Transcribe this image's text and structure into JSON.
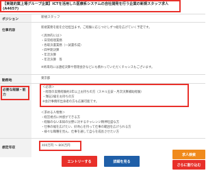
{
  "header": {
    "title_line1": "【東建的業上場グループ企業】ICTを活用した医療系システムの自社開発を行う企業の新規スタッフ求人",
    "title_line2": "(A4657)"
  },
  "position": {
    "label": "ポジション",
    "value": "新規スタッフ"
  },
  "job": {
    "label": "仕事内容",
    "lines": [
      "新規業務を能を企社担当ます。ご経験に応じつけしずつ組を広げていく予定です。",
      "",
      "＜具体的には＞",
      "・日常経理業務",
      "・各取決書業務（一試書作成）",
      "・四半期決算",
      "・年次決算",
      "・年次決算　等",
      "",
      "※将来的には連結決算や管理会計などにも携わっていただくチャンスもございます。"
    ]
  },
  "location": {
    "label": "勤務地",
    "value": "東京都"
  },
  "requirements": {
    "label": "必要な経験・能力",
    "must_lines": [
      "＜必須＞",
      "・経理の実務経験約3年以上お持ちの方（スキル五安・月次決算補助経験）",
      "・簿記2級をお持ちの方",
      "※会計事務所出身者の方も応募可能です。"
    ],
    "ideal_lines": [
      "＜求める人物像＞",
      "・経営視点に共感ができる方",
      "・経験のない未知の分野に対するチャレンジ精神旺盛な方",
      "・仕事の幅を広げたい、好奇心を持って仕事の範囲を広げられる方",
      "・様々な職種を見ん、仕事を通して自らを成長させたい方"
    ]
  },
  "salary": {
    "label": "想定年収",
    "value": "400万円 ～ 800万円"
  },
  "buttons": {
    "apply": "エントリーする",
    "detail": "詳細を見る",
    "side_a": "求人検索",
    "side_b": "さらに割り込む"
  }
}
